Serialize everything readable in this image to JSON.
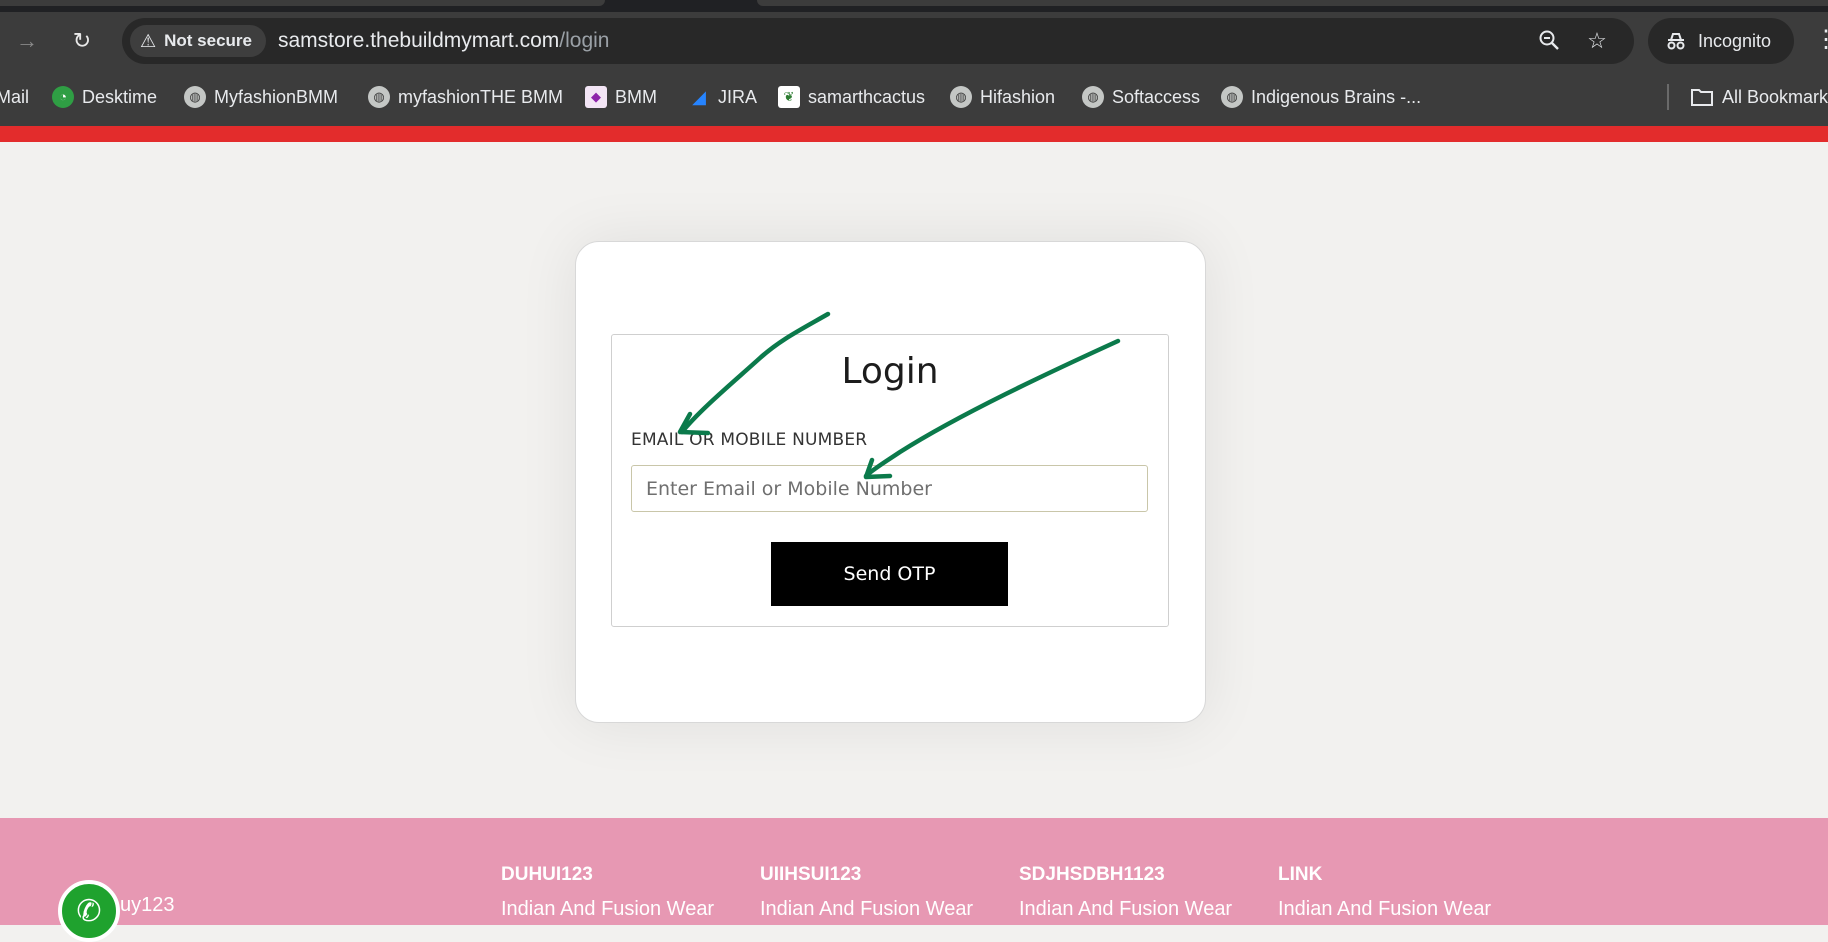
{
  "browser": {
    "security_label": "Not secure",
    "url_host": "samstore.thebuildmymart.com",
    "url_path": "/login",
    "incognito_label": "Incognito",
    "bookmarks": [
      {
        "label": "Mail",
        "icon": "mail-icon"
      },
      {
        "label": "Desktime",
        "icon": "desktime-icon"
      },
      {
        "label": "MyfashionBMM",
        "icon": "globe-icon"
      },
      {
        "label": "myfashionTHE BMM",
        "icon": "globe-icon"
      },
      {
        "label": "BMM",
        "icon": "bmm-icon"
      },
      {
        "label": "JIRA",
        "icon": "jira-icon"
      },
      {
        "label": "samarthcactus",
        "icon": "cactus-icon"
      },
      {
        "label": "Hifashion",
        "icon": "globe-icon"
      },
      {
        "label": "Softaccess",
        "icon": "globe-icon"
      },
      {
        "label": "Indigenous Brains -...",
        "icon": "globe-icon"
      }
    ],
    "all_bookmarks_label": "All Bookmarks"
  },
  "login": {
    "title": "Login",
    "field_label": "EMAIL OR MOBILE NUMBER",
    "input_placeholder": "Enter Email or Mobile Number",
    "input_value": "",
    "button_label": "Send OTP"
  },
  "footer": {
    "brand": "uy123",
    "columns": [
      {
        "heading": "DUHUI123",
        "text": "Indian And Fusion Wear"
      },
      {
        "heading": "UIIHSUI123",
        "text": "Indian And Fusion Wear"
      },
      {
        "heading": "SDJHSDBH1123",
        "text": "Indian And Fusion Wear"
      },
      {
        "heading": "LINK",
        "text": "Indian And Fusion Wear"
      }
    ]
  },
  "colors": {
    "accent_red": "#e32c2c",
    "footer_pink": "#e798b3",
    "annotation_green": "#0b7a4b",
    "button_black": "#000000"
  }
}
